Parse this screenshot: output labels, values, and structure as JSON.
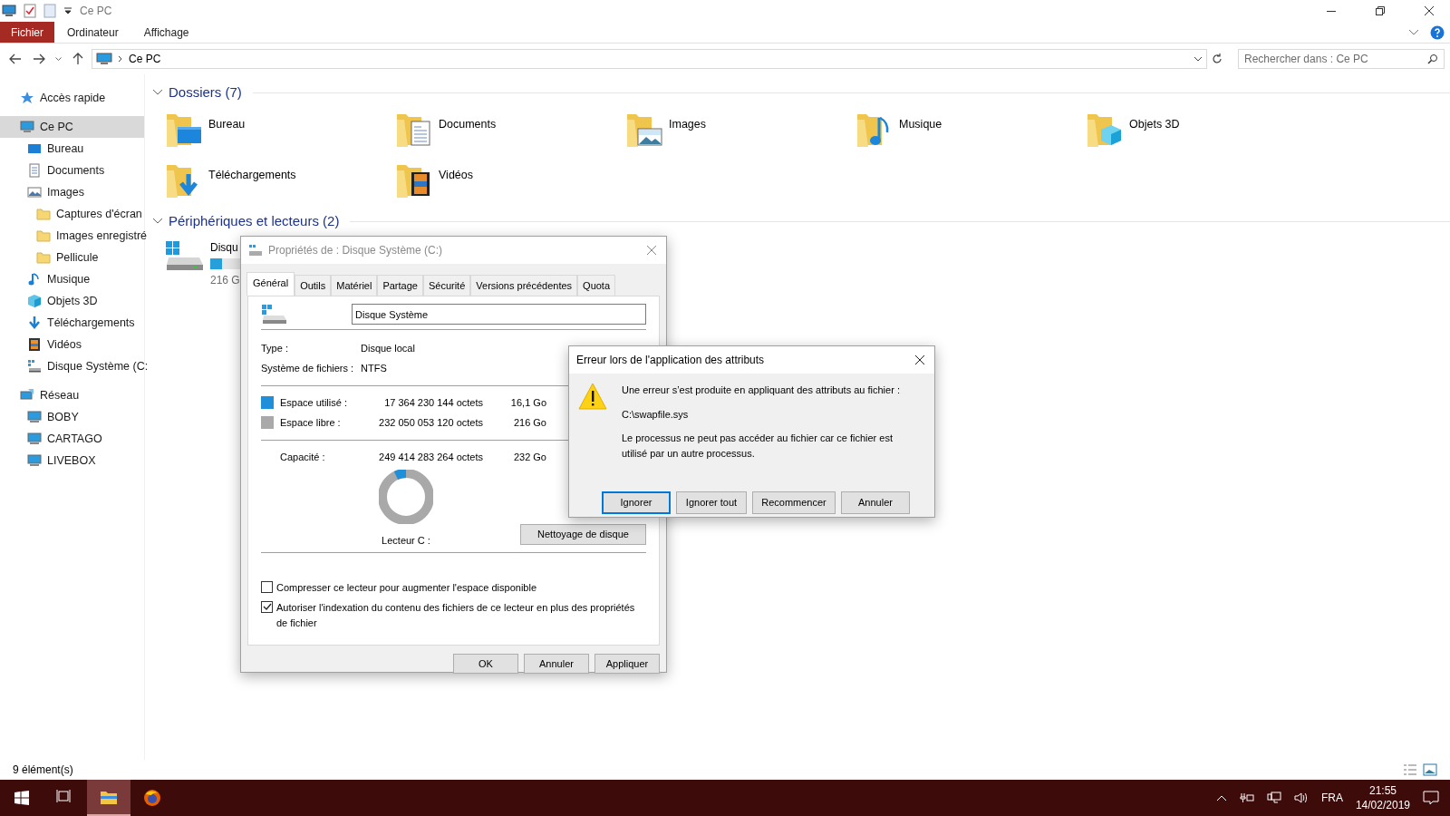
{
  "window": {
    "title": "Ce PC"
  },
  "ribbon_tabs": [
    {
      "label": "Fichier",
      "kind": "file"
    },
    {
      "label": "Ordinateur",
      "kind": "tab"
    },
    {
      "label": "Affichage",
      "kind": "tab"
    }
  ],
  "address": {
    "path": "Ce PC"
  },
  "search": {
    "placeholder": "Rechercher dans : Ce PC"
  },
  "sidebar": {
    "items": [
      {
        "label": "Accès rapide",
        "kind": "star",
        "selected": false
      },
      {
        "label": "Ce PC",
        "kind": "pc",
        "selected": true,
        "children": [
          {
            "label": "Bureau",
            "kind": "desktop",
            "selected": false
          },
          {
            "label": "Documents",
            "kind": "document",
            "selected": false
          },
          {
            "label": "Images",
            "kind": "image",
            "selected": false,
            "children": [
              {
                "label": "Captures d'écran",
                "kind": "folder",
                "selected": false
              },
              {
                "label": "Images enregistré",
                "kind": "folder",
                "selected": false
              },
              {
                "label": "Pellicule",
                "kind": "folder",
                "selected": false
              }
            ]
          },
          {
            "label": "Musique",
            "kind": "music",
            "selected": false
          },
          {
            "label": "Objets 3D",
            "kind": "cube",
            "selected": false
          },
          {
            "label": "Téléchargements",
            "kind": "download",
            "selected": false
          },
          {
            "label": "Vidéos",
            "kind": "video",
            "selected": false
          },
          {
            "label": "Disque Système (C:",
            "kind": "drive",
            "selected": false
          }
        ]
      },
      {
        "label": "Réseau",
        "kind": "network",
        "selected": false,
        "children": [
          {
            "label": "BOBY",
            "kind": "computer",
            "selected": false
          },
          {
            "label": "CARTAGO",
            "kind": "computer",
            "selected": false
          },
          {
            "label": "LIVEBOX",
            "kind": "computer",
            "selected": false
          }
        ]
      }
    ]
  },
  "folders": {
    "title": "Dossiers (7)",
    "expanded": true,
    "items": [
      {
        "name": "Bureau",
        "kind": "desktop"
      },
      {
        "name": "Documents",
        "kind": "document"
      },
      {
        "name": "Images",
        "kind": "image"
      },
      {
        "name": "Musique",
        "kind": "music"
      },
      {
        "name": "Objets 3D",
        "kind": "cube"
      },
      {
        "name": "Téléchargements",
        "kind": "download"
      },
      {
        "name": "Vidéos",
        "kind": "video"
      }
    ]
  },
  "drives": {
    "title": "Périphériques et lecteurs (2)",
    "expanded": true,
    "items": [
      {
        "name": "Disqu",
        "level": 0.07,
        "free": "216 G"
      }
    ]
  },
  "status_bar": {
    "count": "9 élément(s)"
  },
  "properties_dialog": {
    "title": "Propriétés de : Disque Système (C:)",
    "tabs": [
      {
        "label": "Général",
        "selected": true
      },
      {
        "label": "Outils",
        "selected": false
      },
      {
        "label": "Matériel",
        "selected": false
      },
      {
        "label": "Partage",
        "selected": false
      },
      {
        "label": "Sécurité",
        "selected": false
      },
      {
        "label": "Versions précédentes",
        "selected": false
      },
      {
        "label": "Quota",
        "selected": false
      }
    ],
    "name_value": "Disque Système",
    "info": [
      {
        "label": "Type :",
        "value": "Disque local"
      },
      {
        "label": "Système de fichiers :",
        "value": "NTFS"
      }
    ],
    "space": [
      {
        "label": "Espace utilisé :",
        "bytes": "17 364 230 144 octets",
        "size": "16,1 Go",
        "color": "#1e8fd8"
      },
      {
        "label": "Espace libre :",
        "bytes": "232 050 053 120 octets",
        "size": "216 Go",
        "color": "#a9a9a9"
      }
    ],
    "capacity": {
      "label": "Capacité :",
      "bytes": "249 414 283 264 octets",
      "size": "232 Go"
    },
    "drive_label": "Lecteur C :",
    "cleanup_button": "Nettoyage de disque",
    "options": [
      {
        "label": "Compresser ce lecteur pour augmenter l'espace disponible",
        "checked": false
      },
      {
        "label": "Autoriser l'indexation du contenu des fichiers de ce lecteur en plus des propriétés de fichier",
        "checked": true
      }
    ],
    "buttons": [
      "OK",
      "Annuler",
      "Appliquer"
    ]
  },
  "error_dialog": {
    "title": "Erreur lors de l'application des attributs",
    "message": "Une erreur s’est produite en appliquant des attributs au fichier :",
    "file": "C:\\swapfile.sys",
    "detail": "Le processus ne peut pas accéder au fichier car ce fichier est utilisé par un autre processus.",
    "buttons": [
      {
        "label": "Ignorer",
        "default": true
      },
      {
        "label": "Ignorer tout",
        "default": false
      },
      {
        "label": "Recommencer",
        "default": false
      },
      {
        "label": "Annuler",
        "default": false
      }
    ]
  },
  "taskbar": {
    "apps": [
      {
        "kind": "task-view",
        "active": false
      },
      {
        "kind": "explorer",
        "active": true
      },
      {
        "kind": "firefox",
        "active": false
      }
    ],
    "language": "FRA",
    "time": "21:55",
    "date": "14/02/2019"
  }
}
